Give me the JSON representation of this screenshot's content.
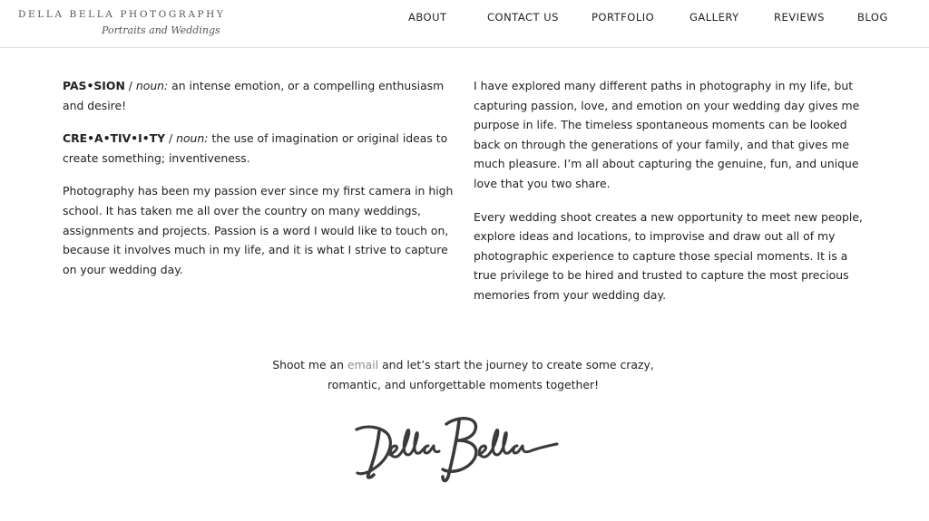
{
  "header": {
    "logo_main": "DELLA BELLA PHOTOGRAPHY",
    "logo_sub": "Portraits and Weddings"
  },
  "nav": [
    "ABOUT",
    "CONTACT US",
    "PORTFOLIO",
    "GALLERY",
    "REVIEWS",
    "BLOG"
  ],
  "left_column": {
    "passion": {
      "term": "PAS•SION",
      "sep": " / ",
      "pos": "noun:",
      "definition": " an intense emotion, or a compelling enthusiasm and desire!"
    },
    "creativity": {
      "term": "CRE•A•TIV•I•TY",
      "sep": " / ",
      "pos": "noun:",
      "definition": " the use of imagination or original ideas to create something; inventiveness."
    },
    "paragraph": "Photography has been my passion ever since my first camera in high school. It has taken me all over the country on many weddings, assignments and projects. Passion is a word I would like to touch on, because it involves much in my life, and it is what I strive to capture on your wedding day."
  },
  "right_column": {
    "paragraph1": "I have explored many different paths in photography in my life, but capturing passion, love, and emotion on your wedding day gives me purpose in life. The timeless spontaneous moments can be looked back on through the generations of your family, and that gives me much pleasure. I’m all about capturing the genuine, fun, and unique love that you two share.",
    "paragraph2": "Every wedding shoot creates a new opportunity to meet new people, explore ideas and locations, to improvise and draw out all of my photographic experience to capture those special moments. It is a true privilege to be hired and trusted to capture the most precious memories from your wedding day."
  },
  "cta": {
    "before": "Shoot me an ",
    "link": "email",
    "line1_after": " and let’s start the journey to create some crazy,",
    "line2": "romantic, and unforgettable moments together!"
  },
  "signature": {
    "text": "Della Bella"
  }
}
